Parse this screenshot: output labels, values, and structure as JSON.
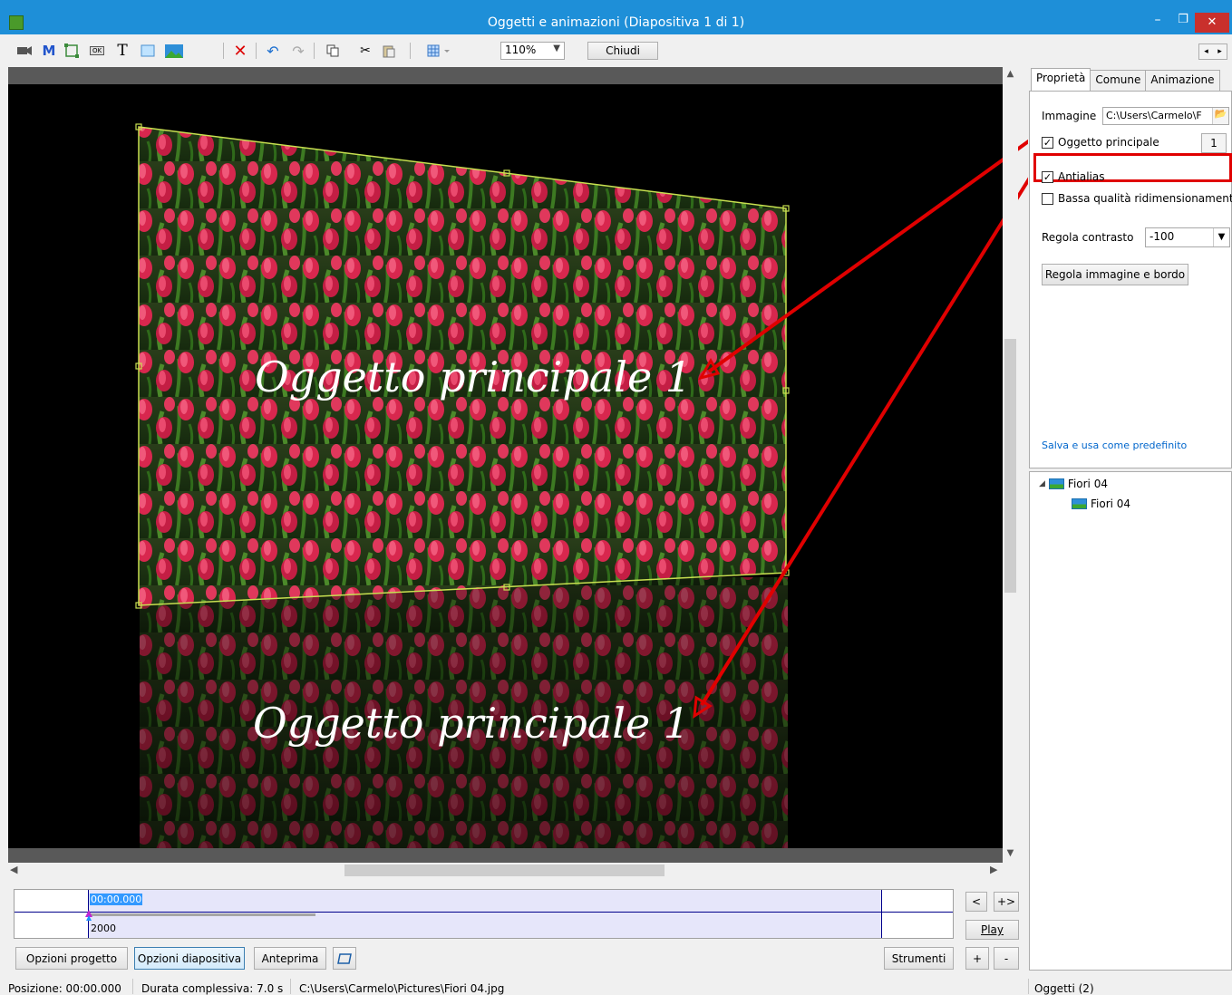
{
  "window": {
    "title": "Oggetti e animazioni  (Diapositiva 1 di 1)",
    "minimize_glyph": "–",
    "restore_glyph": "❐",
    "close_glyph": "✕"
  },
  "toolbar": {
    "icons": [
      "camera-icon",
      "mask-icon",
      "frame-icon",
      "button-icon",
      "text-icon",
      "rectangle-icon",
      "image-icon",
      "delete-icon",
      "undo-icon",
      "redo-icon",
      "copy-icon",
      "cut-icon",
      "paste-icon",
      "grid-icon"
    ],
    "text_glyph": "T",
    "mask_glyph": "M",
    "button_glyph": "OK",
    "zoom_value": "110%",
    "close_label": "Chiudi"
  },
  "canvas": {
    "caption_top": "Oggetto principale 1",
    "caption_bottom": "Oggetto principale 1",
    "accent_color": "#e00000",
    "handle_color": "#c8e050"
  },
  "timeline": {
    "current_time": "00:00.000",
    "duration": "2000",
    "prev_label": "<",
    "expand_label": "+>",
    "play_label": "Play",
    "plus_label": "+",
    "minus_label": "-"
  },
  "bottom_buttons": {
    "project_options": "Opzioni progetto",
    "slide_options": "Opzioni diapositiva",
    "preview": "Anteprima",
    "tools": "Strumenti"
  },
  "sidepanel": {
    "tabs": [
      "Proprietà",
      "Comune",
      "Animazione"
    ],
    "image_label": "Immagine",
    "image_path": "C:\\Users\\Carmelo\\F",
    "main_object_label": "Oggetto principale",
    "main_object_checked": true,
    "main_object_number": "1",
    "antialias_label": "Antialias",
    "antialias_checked": true,
    "low_quality_label": "Bassa qualità ridimensionamento",
    "low_quality_checked": false,
    "contrast_label": "Regola contrasto",
    "contrast_value": "-100",
    "adjust_button": "Regola immagine e bordo",
    "save_default_link": "Salva e usa come predefinito",
    "tree": [
      {
        "label": "Fiori 04",
        "level": 0
      },
      {
        "label": "Fiori 04",
        "level": 1
      }
    ]
  },
  "statusbar": {
    "position": "Posizione:  00:00.000",
    "total_duration": "Durata complessiva:  7.0 s",
    "file_path": "C:\\Users\\Carmelo\\Pictures\\Fiori 04.jpg",
    "objects_count": "Oggetti (2)"
  }
}
